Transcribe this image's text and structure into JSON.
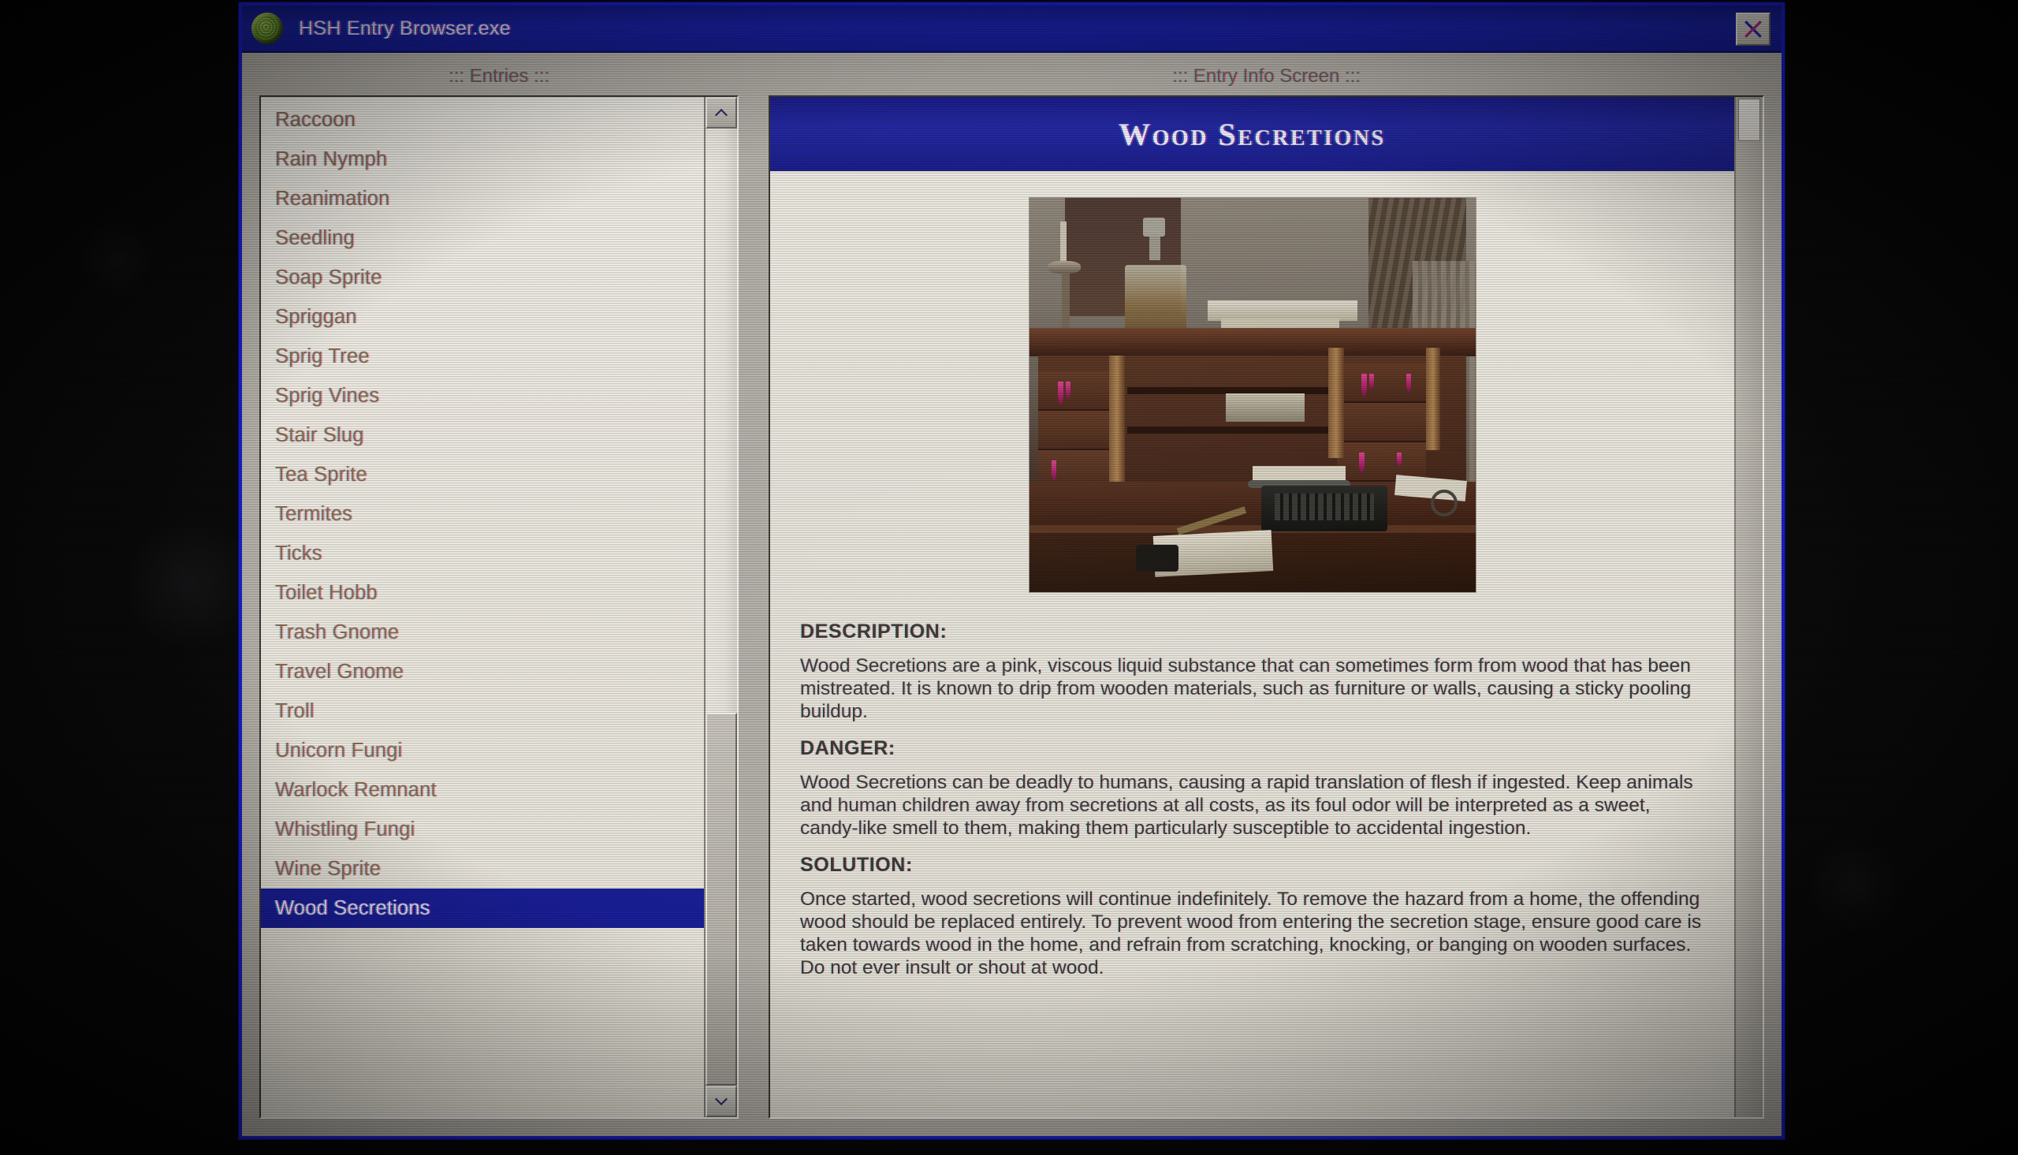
{
  "window": {
    "title": "HSH Entry Browser.exe",
    "icon": "moldy-sphere-icon",
    "close_label": "close-icon",
    "border_color": "#1b1fd0",
    "titlebar_color": "#1a22a8"
  },
  "left_panel": {
    "caption": "::: Entries :::",
    "items": [
      "Raccoon",
      "Rain Nymph",
      "Reanimation",
      "Seedling",
      "Soap Sprite",
      "Spriggan",
      "Sprig Tree",
      "Sprig Vines",
      "Stair Slug",
      "Tea Sprite",
      "Termites",
      "Ticks",
      "Toilet Hobb",
      "Trash Gnome",
      "Travel Gnome",
      "Troll",
      "Unicorn Fungi",
      "Warlock Remnant",
      "Whistling Fungi",
      "Wine Sprite",
      "Wood Secretions"
    ],
    "selected_index": 20,
    "selection_color": "#1a1f9c",
    "item_text_color": "#8a7150",
    "scroll_up_label": "^",
    "scroll_down_label": "v"
  },
  "right_panel": {
    "caption": "::: Entry Info Screen :::",
    "entry_title": "Wood Secretions",
    "photo_alt": "vintage-desk-with-typewriter-and-pink-secretions",
    "sections": [
      {
        "heading": "DESCRIPTION:",
        "body": "Wood Secretions are a pink, viscous liquid substance that can sometimes form from wood that has been mistreated. It is known to drip from wooden materials, such as furniture or walls, causing a sticky pooling buildup."
      },
      {
        "heading": "DANGER:",
        "body": "Wood Secretions can be deadly to humans, causing a rapid translation of flesh if  ingested. Keep animals and human children away from secretions at all costs, as its foul odor will be interpreted as a sweet, candy-like smell to them, making them particularly susceptible to accidental ingestion."
      },
      {
        "heading": "SOLUTION:",
        "body": "Once started, wood secretions will continue indefinitely. To remove the hazard from a home, the offending wood should be replaced entirely. To prevent wood from entering the secretion stage, ensure good care is taken towards wood in the home, and refrain from scratching, knocking, or banging on wooden surfaces. Do not ever insult or shout at wood."
      }
    ]
  }
}
